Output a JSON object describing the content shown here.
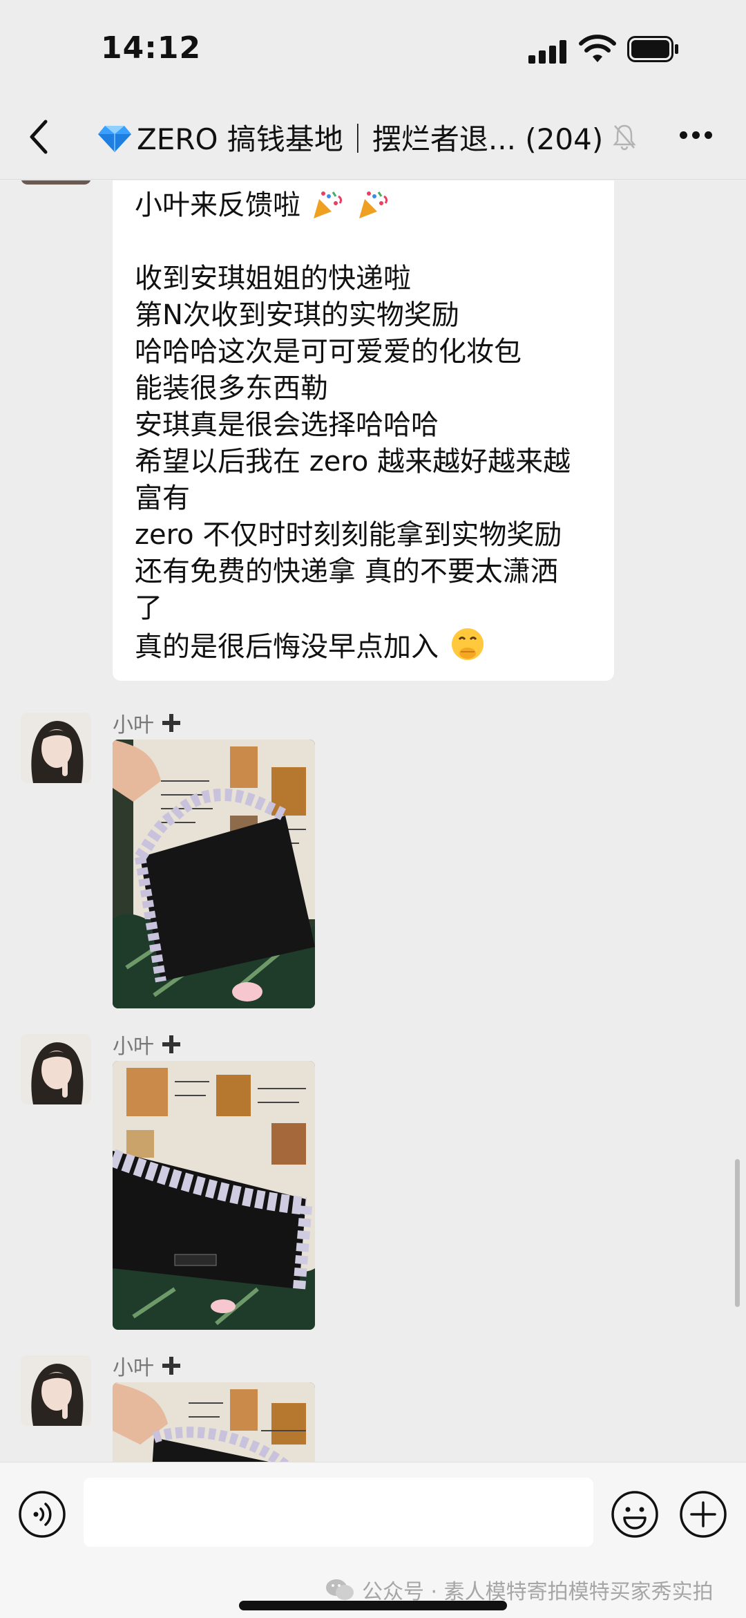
{
  "status_bar": {
    "time": "14:12"
  },
  "nav": {
    "title": "ZERO 搞钱基地｜摆烂者退... (204)",
    "back_icon": "chevron-left-icon",
    "title_icon": "blue-diamond-icon",
    "mute_icon": "bell-muted-icon",
    "more_icon": "more-dots-icon"
  },
  "text_message": {
    "lines": [
      "小叶来反馈啦",
      "",
      "收到安琪姐姐的快递啦",
      "第N次收到安琪的实物奖励",
      "哈哈哈这次是可可爱爱的化妆包",
      "能装很多东西勒",
      "安琪真是很会选择哈哈哈",
      "希望以后我在 zero 越来越好越来越",
      "富有",
      "zero 不仅时时刻刻能拿到实物奖励",
      "还有免费的快递拿 真的不要太潇洒",
      "了",
      "真的是很后悔没早点加入"
    ],
    "first_line_emoji": "party-popper-icon",
    "last_line_emoji": "face-hand-over-mouth-icon"
  },
  "messages": [
    {
      "sender": "小叶",
      "type": "image",
      "image_desc": "black-cosmetic-bag-photo"
    },
    {
      "sender": "小叶",
      "type": "image",
      "image_desc": "black-cosmetic-bag-photo"
    },
    {
      "sender": "小叶",
      "type": "image",
      "image_desc": "black-cosmetic-bag-photo"
    }
  ],
  "input_bar": {
    "voice_icon": "voice-icon",
    "emoji_icon": "smiley-icon",
    "plus_icon": "plus-circle-icon",
    "watermark": "公众号 · 素人模特寄拍模特买家秀实拍"
  },
  "colors": {
    "background": "#ededed",
    "bubble": "#ffffff",
    "diamond": "#3aa0ff",
    "mute": "#b3b3b3"
  }
}
